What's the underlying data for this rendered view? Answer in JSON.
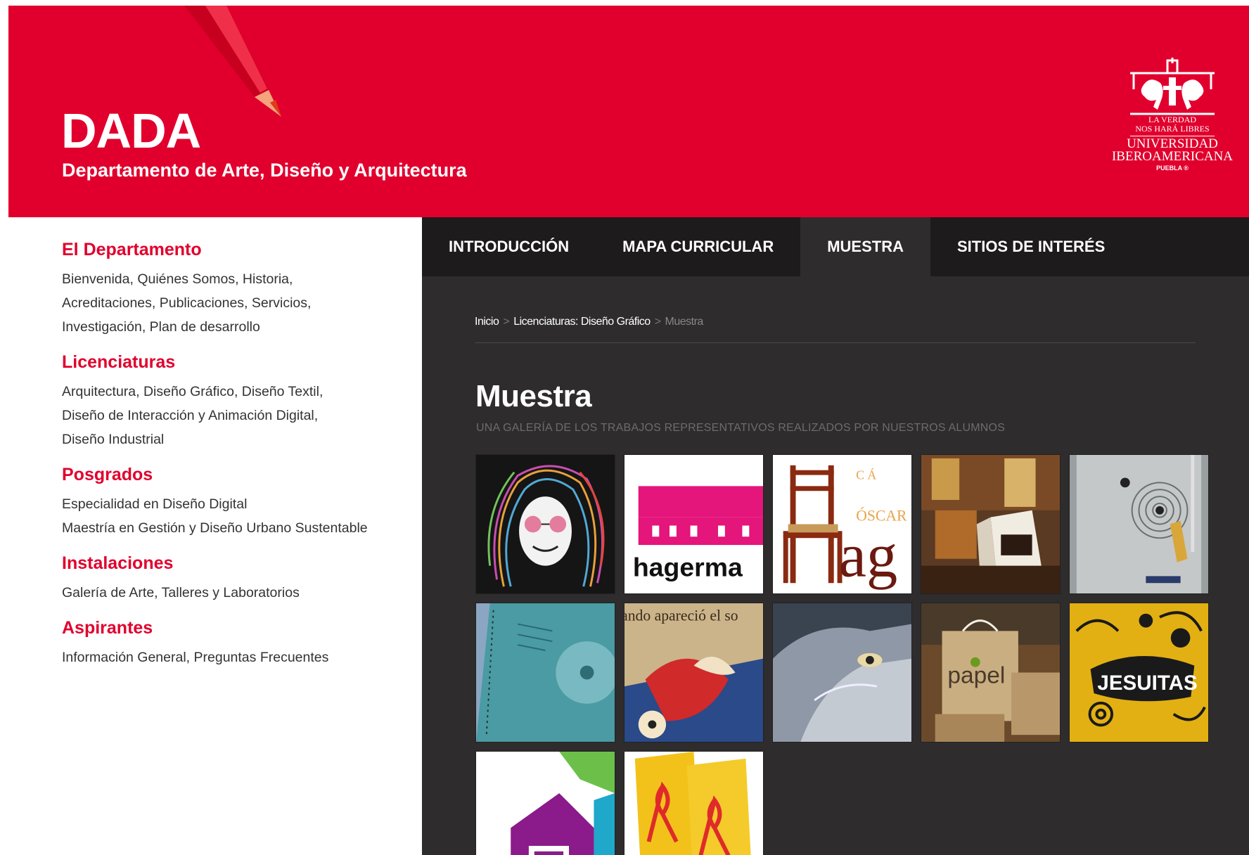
{
  "header": {
    "title": "DADA",
    "subtitle": "Departamento de Arte, Diseño y Arquitectura",
    "logo": {
      "motto_line1": "LA VERDAD",
      "motto_line2": "NOS HARÁ LIBRES",
      "name_line1": "UNIVERSIDAD",
      "name_line2": "IBEROAMERICANA",
      "city": "PUEBLA ®"
    },
    "accent_color": "#e1002d"
  },
  "sidebar": {
    "sections": [
      {
        "heading": "El Departamento",
        "lines": [
          "Bienvenida, Quiénes Somos, Historia,",
          "Acreditaciones, Publicaciones, Servicios,",
          "Investigación, Plan de desarrollo"
        ]
      },
      {
        "heading": "Licenciaturas",
        "lines": [
          "Arquitectura, Diseño Gráfico, Diseño Textil,",
          "Diseño de Interacción y Animación Digital,",
          "Diseño Industrial"
        ]
      },
      {
        "heading": "Posgrados",
        "lines": [
          "Especialidad en Diseño Digital",
          "Maestría en Gestión y Diseño Urbano Sustentable"
        ]
      },
      {
        "heading": "Instalaciones",
        "lines": [
          "Galería de Arte, Talleres y Laboratorios"
        ]
      },
      {
        "heading": "Aspirantes",
        "lines": [
          "Información General, Preguntas Frecuentes"
        ]
      }
    ]
  },
  "nav": {
    "items": [
      "INTRODUCCIÓN",
      "MAPA CURRICULAR",
      "MUESTRA",
      "SITIOS DE INTERÉS"
    ],
    "active": "MUESTRA"
  },
  "breadcrumb": {
    "items": [
      "Inicio",
      "Licenciaturas: Diseño Gráfico",
      "Muestra"
    ],
    "separator": ">"
  },
  "page": {
    "title": "Muestra",
    "subtitle": "UNA GALERÍA DE LOS TRABAJOS REPRESENTATIVOS REALIZADOS POR NUESTROS ALUMNOS"
  },
  "gallery": {
    "thumb_texts": {
      "hagerman": "hagerma",
      "oscar_top": "C   Á",
      "oscar": "ÓSCAR",
      "ag": "ag",
      "aparecio": "ando apareció  el so",
      "papel": "papel",
      "jesuitas": "JESUITAS"
    }
  }
}
